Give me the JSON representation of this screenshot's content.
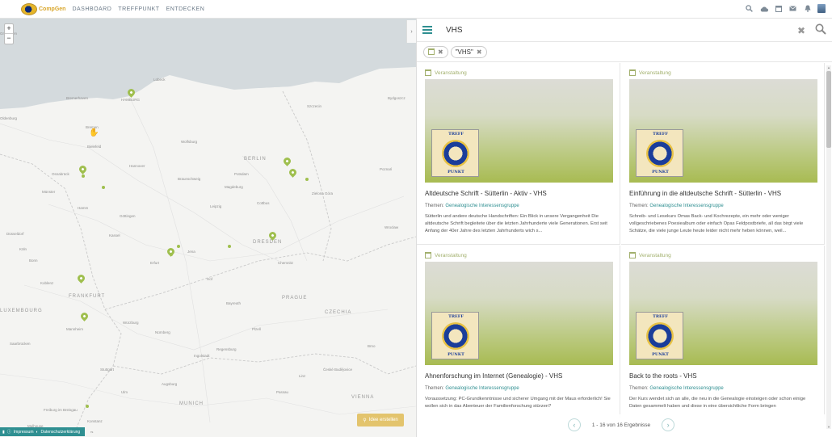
{
  "app": {
    "logo_text": "CompGen",
    "nav": [
      "DASHBOARD",
      "TREFFPUNKT",
      "ENTDECKEN"
    ],
    "top_icons": [
      "search-icon",
      "cloud-icon",
      "calendar-icon",
      "mail-icon",
      "bell-icon",
      "avatar"
    ]
  },
  "map": {
    "zoom_in": "+",
    "zoom_out": "−",
    "collapse": "›",
    "create_button": "Idee erstellen",
    "footer": {
      "impressum": "Impressum",
      "datenschutz": "Datenschutzerklärung"
    },
    "attribution": "rs",
    "labels": [
      "HAMBURG",
      "Lübeck",
      "Bremerhaven",
      "Bremen",
      "Oldenburg",
      "Osnabrück",
      "Münster",
      "Hannover",
      "Braunschweig",
      "Magdeburg",
      "Göttingen",
      "Kassel",
      "Düsseldorf",
      "Köln",
      "Bonn",
      "Koblenz",
      "FRANKFURT",
      "Mannheim",
      "Saarbrücken",
      "Stuttgart",
      "Nürnberg",
      "Regensburg",
      "BERLIN",
      "Potsdam",
      "Cottbus",
      "DRESDEN",
      "Leipzig",
      "Jena",
      "PRAGUE",
      "CZECHIA",
      "Plzeň",
      "Brno",
      "Würzburg",
      "Ingolstadt",
      "MUNICH",
      "VIENNA",
      "Linz",
      "Freiburg im Breisgau",
      "Mulhouse",
      "Szczecin",
      "Zielona Góra",
      "Poznań",
      "LUXEMBOURG",
      "Groningen",
      "Bydgoszcz",
      "Hamm",
      "Hof",
      "Erfurt",
      "Bayreuth",
      "Passau",
      "České Budějovice",
      "Augsburg",
      "Ulm",
      "Konstanz",
      "Bielefeld",
      "Wolfsburg",
      "Chemnitz",
      "Wrocław"
    ]
  },
  "panel": {
    "search_value": "VHS",
    "chips": [
      {
        "label": "",
        "icon": "calendar-icon"
      },
      {
        "label": "\"VHS\""
      }
    ],
    "cards": [
      {
        "type": "Veranstaltung",
        "title": "Altdeutsche Schrift - Sütterlin - Aktiv - VHS",
        "topic_prefix": "Themen:",
        "topic": "Genealogische Interessensgruppe",
        "desc": "Sütterlin und andere deutsche Handschriften: Ein Blick in unsere Vergangenheit Die altdeutsche Schrift begleitete über die letzten Jahrhunderte viele Generationen. Erst seit Anfang der 40er Jahre des letzten Jahrhunderts wich s..."
      },
      {
        "type": "Veranstaltung",
        "title": "Einführung in die altdeutsche Schrift - Sütterlin - VHS",
        "topic_prefix": "Themen:",
        "topic": "Genealogische Interessensgruppe",
        "desc": "Schreib- und Lesekurs Omas Back- und Kochrezepte, ein mehr oder weniger vollgeschriebenes Poesiealbum oder einfach Opas Feldpostbriefe, all das birgt viele Schätze, die viele junge Leute heute leider nicht mehr heben können, weil..."
      },
      {
        "type": "Veranstaltung",
        "title": "Ahnenforschung im Internet (Genealogie) - VHS",
        "topic_prefix": "Themen:",
        "topic": "Genealogische Interessensgruppe",
        "desc": "Voraussetzung: PC-Grundkenntnisse und sicherer Umgang mit der Maus erforderlich! Sie wollen sich in das Abenteuer der Familienforschung stürzen?"
      },
      {
        "type": "Veranstaltung",
        "title": "Back to the roots - VHS",
        "topic_prefix": "Themen:",
        "topic": "Genealogische Interessensgruppe",
        "desc": "Der Kurs wendet sich an alle, die neu in die Genealogie einsteigen oder schon einige Daten gesammelt haben und diese in eine übersichtliche Form bringen"
      }
    ],
    "emblem": {
      "top": "TREFF",
      "bottom": "PUNKT"
    },
    "pager": {
      "prev": "‹",
      "text": "1 - 16 von 16 Ergebnisse",
      "next": "›"
    }
  },
  "colors": {
    "accent": "#2f8f91",
    "event_green": "#a2b06d",
    "marker": "#9fbf4e",
    "create_btn": "#e3c46d"
  }
}
